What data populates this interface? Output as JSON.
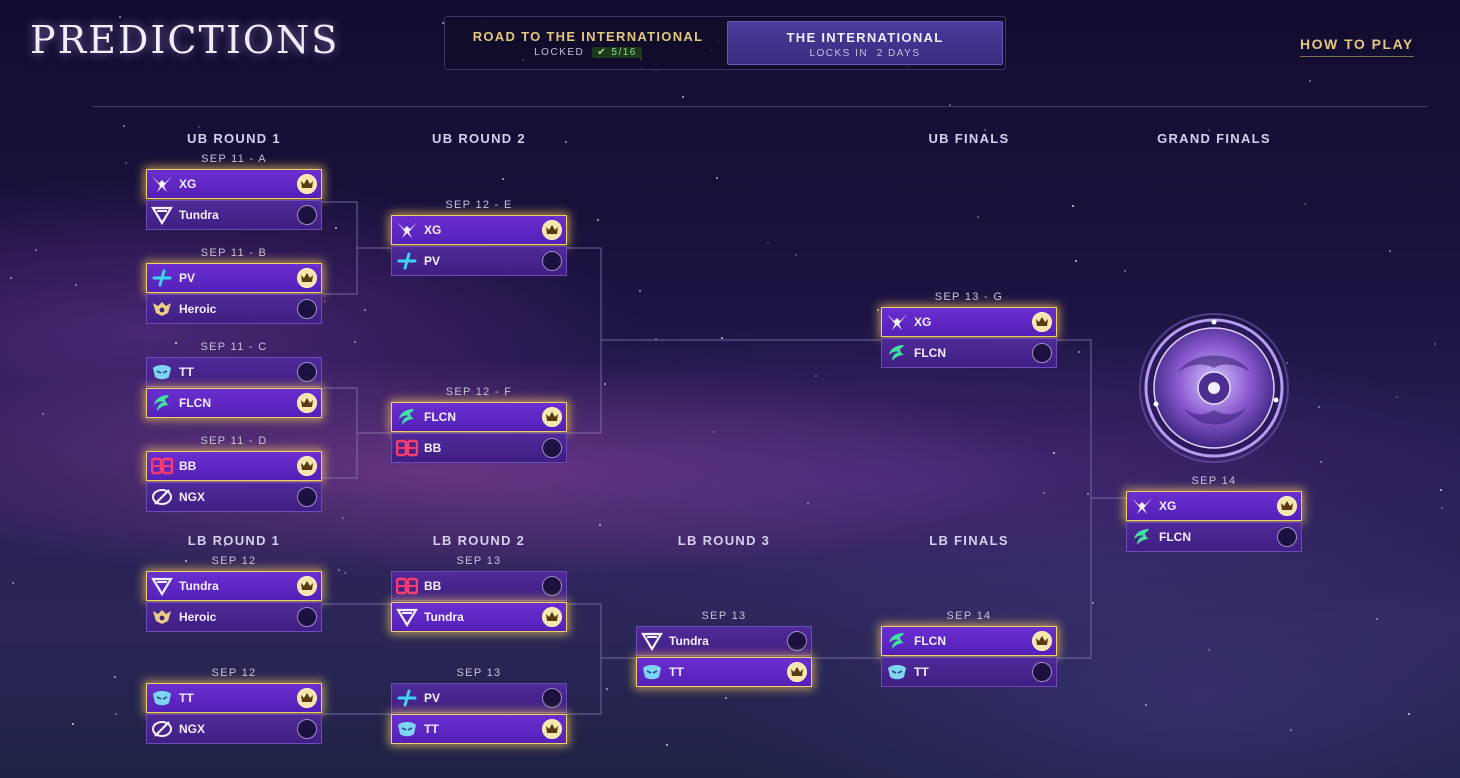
{
  "header": {
    "title": "PREDICTIONS",
    "road_tab": {
      "name": "ROAD TO THE INTERNATIONAL",
      "status": "LOCKED",
      "progress": "5/16"
    },
    "ti_tab": {
      "name": "THE INTERNATIONAL",
      "status": "LOCKS IN  2 DAYS"
    },
    "how_to_play": "HOW TO PLAY"
  },
  "rounds": {
    "ub_round_1": "UB ROUND 1",
    "ub_round_2": "UB ROUND 2",
    "ub_finals": "UB FINALS",
    "grand_finals": "GRAND FINALS",
    "lb_round_1": "LB ROUND 1",
    "lb_round_2": "LB ROUND 2",
    "lb_round_3": "LB ROUND 3",
    "lb_finals": "LB FINALS"
  },
  "matches": {
    "ub1a": {
      "date": "SEP 11 - A",
      "teams": [
        {
          "name": "XG",
          "logo": "xg-logo",
          "picked": true
        },
        {
          "name": "Tundra",
          "logo": "tundra-logo",
          "picked": false
        }
      ]
    },
    "ub1b": {
      "date": "SEP 11 - B",
      "teams": [
        {
          "name": "PV",
          "logo": "pv-logo",
          "picked": true
        },
        {
          "name": "Heroic",
          "logo": "heroic-logo",
          "picked": false
        }
      ]
    },
    "ub1c": {
      "date": "SEP 11 - C",
      "teams": [
        {
          "name": "TT",
          "logo": "tt-logo",
          "picked": false
        },
        {
          "name": "FLCN",
          "logo": "flcn-logo",
          "picked": true
        }
      ]
    },
    "ub1d": {
      "date": "SEP 11 - D",
      "teams": [
        {
          "name": "BB",
          "logo": "bb-logo",
          "picked": true
        },
        {
          "name": "NGX",
          "logo": "ngx-logo",
          "picked": false
        }
      ]
    },
    "ub2e": {
      "date": "SEP 12 - E",
      "teams": [
        {
          "name": "XG",
          "logo": "xg-logo",
          "picked": true
        },
        {
          "name": "PV",
          "logo": "pv-logo",
          "picked": false
        }
      ]
    },
    "ub2f": {
      "date": "SEP 12 - F",
      "teams": [
        {
          "name": "FLCN",
          "logo": "flcn-logo",
          "picked": true
        },
        {
          "name": "BB",
          "logo": "bb-logo",
          "picked": false
        }
      ]
    },
    "ubfg": {
      "date": "SEP 13 - G",
      "teams": [
        {
          "name": "XG",
          "logo": "xg-logo",
          "picked": true
        },
        {
          "name": "FLCN",
          "logo": "flcn-logo",
          "picked": false
        }
      ]
    },
    "gf": {
      "date": "SEP 14",
      "teams": [
        {
          "name": "XG",
          "logo": "xg-logo",
          "picked": true
        },
        {
          "name": "FLCN",
          "logo": "flcn-logo",
          "picked": false
        }
      ]
    },
    "lb1a": {
      "date": "SEP 12",
      "teams": [
        {
          "name": "Tundra",
          "logo": "tundra-logo",
          "picked": true
        },
        {
          "name": "Heroic",
          "logo": "heroic-logo",
          "picked": false
        }
      ]
    },
    "lb1b": {
      "date": "SEP 12",
      "teams": [
        {
          "name": "TT",
          "logo": "tt-logo",
          "picked": true
        },
        {
          "name": "NGX",
          "logo": "ngx-logo",
          "picked": false
        }
      ]
    },
    "lb2a": {
      "date": "SEP 13",
      "teams": [
        {
          "name": "BB",
          "logo": "bb-logo",
          "picked": false
        },
        {
          "name": "Tundra",
          "logo": "tundra-logo",
          "picked": true
        }
      ]
    },
    "lb2b": {
      "date": "SEP 13",
      "teams": [
        {
          "name": "PV",
          "logo": "pv-logo",
          "picked": false
        },
        {
          "name": "TT",
          "logo": "tt-logo",
          "picked": true
        }
      ]
    },
    "lb3": {
      "date": "SEP 13",
      "teams": [
        {
          "name": "Tundra",
          "logo": "tundra-logo",
          "picked": false
        },
        {
          "name": "TT",
          "logo": "tt-logo",
          "picked": true
        }
      ]
    },
    "lbf": {
      "date": "SEP 14",
      "teams": [
        {
          "name": "FLCN",
          "logo": "flcn-logo",
          "picked": true
        },
        {
          "name": "TT",
          "logo": "tt-logo",
          "picked": false
        }
      ]
    }
  },
  "colors": {
    "accent_gold": "#e4c77e",
    "win_border": "#f1cf68",
    "row_purple": "#4f2a99",
    "row_purple_win": "#6a2fd0"
  },
  "trophy_icon": "aegis-icon"
}
